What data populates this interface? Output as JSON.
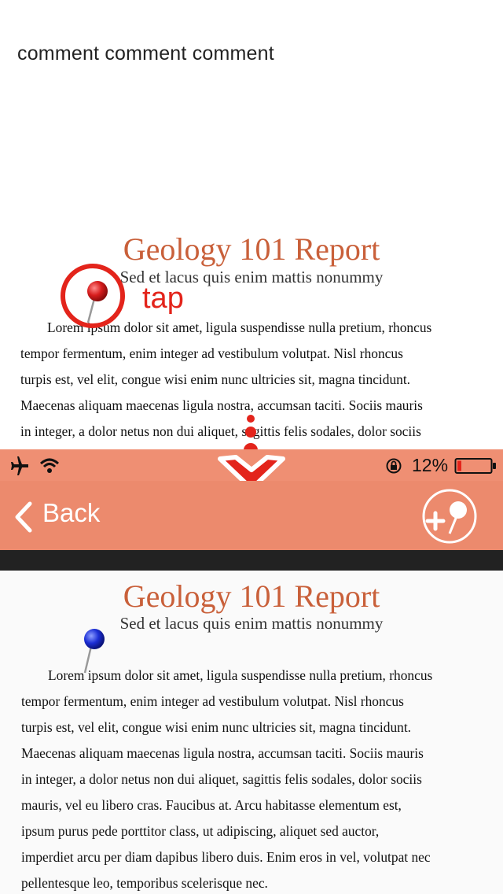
{
  "comment": "comment comment comment",
  "document": {
    "title": "Geology 101 Report",
    "subtitle": "Sed et lacus quis enim mattis nonummy",
    "paragraph_lines": [
      "Lorem ipsum dolor sit amet, ligula suspendisse nulla pretium, rhoncus",
      "tempor fermentum, enim integer ad vestibulum volutpat. Nisl rhoncus",
      "turpis est, vel elit, congue wisi enim nunc ultricies sit, magna tincidunt.",
      "Maecenas aliquam maecenas ligula nostra, accumsan taciti. Sociis mauris",
      "in integer, a dolor netus non dui aliquet, sagittis felis sodales, dolor sociis",
      "mauris, vel eu libero cras. Faucibus at. Arcu habitasse elementum est,",
      "ipsum purus pede porttitor class, ut adipiscing, aliquet sed auctor,",
      "imperdiet arcu per diam dapibus libero duis. Enim eros in vel, volutpat nec",
      "pellentesque leo, temporibus scelerisque nec."
    ]
  },
  "annotation": {
    "tap_label": "tap"
  },
  "status_bar": {
    "icons": [
      "airplane-icon",
      "wifi-icon",
      "rotation-lock-icon",
      "battery-icon"
    ],
    "battery_percent": "12%"
  },
  "nav": {
    "back_label": "Back",
    "action_icon": "add-pin-icon"
  },
  "colors": {
    "accent": "#ec8a6d",
    "title": "#c9603a",
    "annotation": "#e3241b",
    "pin_red": "#d71d1d",
    "pin_blue": "#1c2fd6"
  }
}
